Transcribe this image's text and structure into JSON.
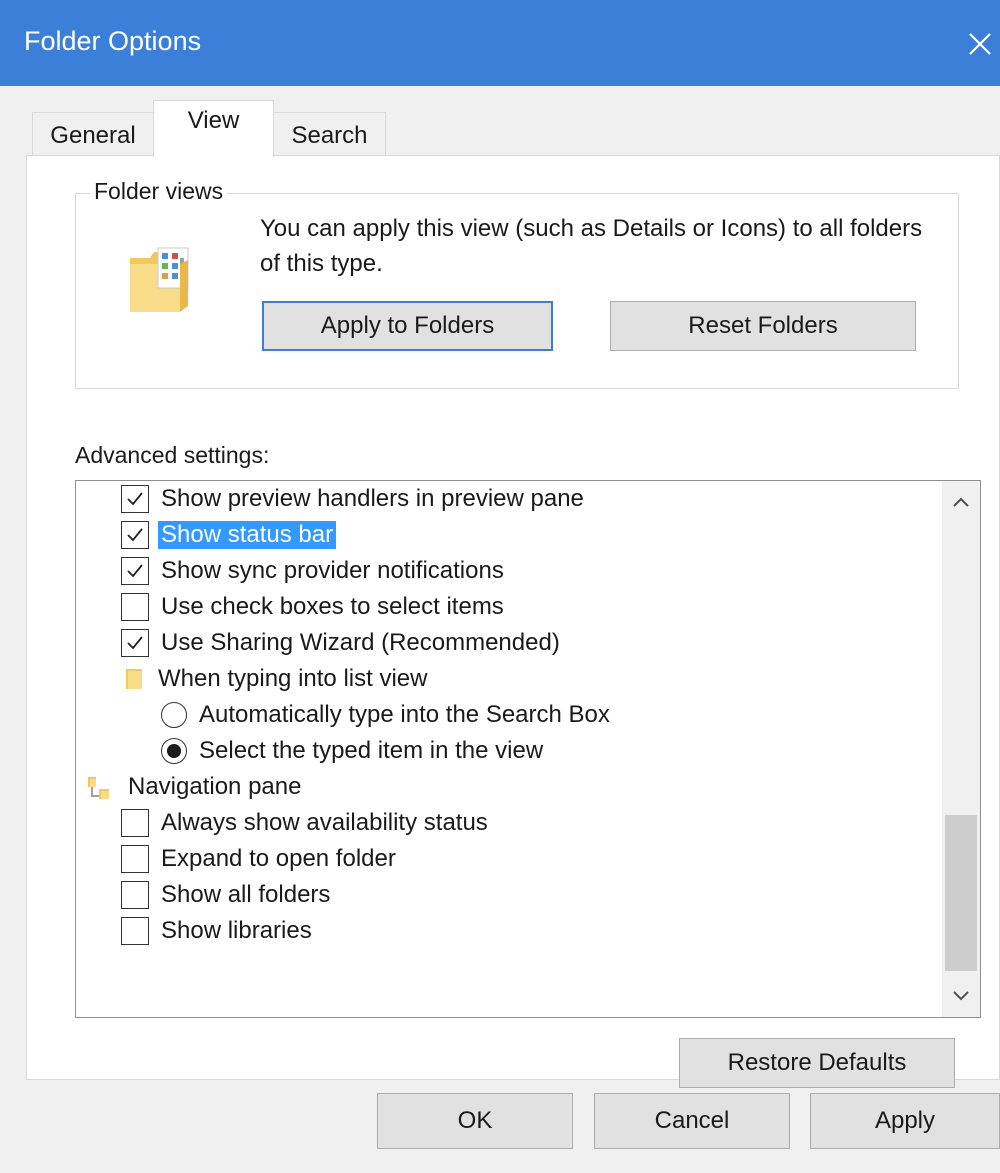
{
  "window": {
    "title": "Folder Options"
  },
  "tabs": [
    {
      "label": "General"
    },
    {
      "label": "View"
    },
    {
      "label": "Search"
    }
  ],
  "folder_views": {
    "group_title": "Folder views",
    "description": "You can apply this view (such as Details or Icons) to all folders of this type.",
    "apply_button": "Apply to Folders",
    "reset_button": "Reset Folders"
  },
  "advanced": {
    "label": "Advanced settings:",
    "items": [
      {
        "type": "checkbox",
        "checked": true,
        "label": "Show preview handlers in preview pane"
      },
      {
        "type": "checkbox",
        "checked": true,
        "label": "Show status bar",
        "selected": true
      },
      {
        "type": "checkbox",
        "checked": true,
        "label": "Show sync provider notifications"
      },
      {
        "type": "checkbox",
        "checked": false,
        "label": "Use check boxes to select items"
      },
      {
        "type": "checkbox",
        "checked": true,
        "label": "Use Sharing Wizard (Recommended)"
      },
      {
        "type": "folder",
        "icon": "folder-icon",
        "label": "When typing into list view"
      },
      {
        "type": "radio",
        "checked": false,
        "label": "Automatically type into the Search Box"
      },
      {
        "type": "radio",
        "checked": true,
        "label": "Select the typed item in the view"
      },
      {
        "type": "folder",
        "icon": "navigation-pane-icon",
        "label": "Navigation pane"
      },
      {
        "type": "checkbox",
        "checked": false,
        "label": "Always show availability status"
      },
      {
        "type": "checkbox",
        "checked": false,
        "label": "Expand to open folder"
      },
      {
        "type": "checkbox",
        "checked": false,
        "label": "Show all folders"
      },
      {
        "type": "checkbox",
        "checked": false,
        "label": "Show libraries"
      }
    ],
    "restore_button": "Restore Defaults"
  },
  "footer": {
    "ok": "OK",
    "cancel": "Cancel",
    "apply": "Apply"
  },
  "colors": {
    "titlebar": "#3c7fd8",
    "selection": "#3399ff",
    "default_button_border": "#3a7fd2"
  }
}
